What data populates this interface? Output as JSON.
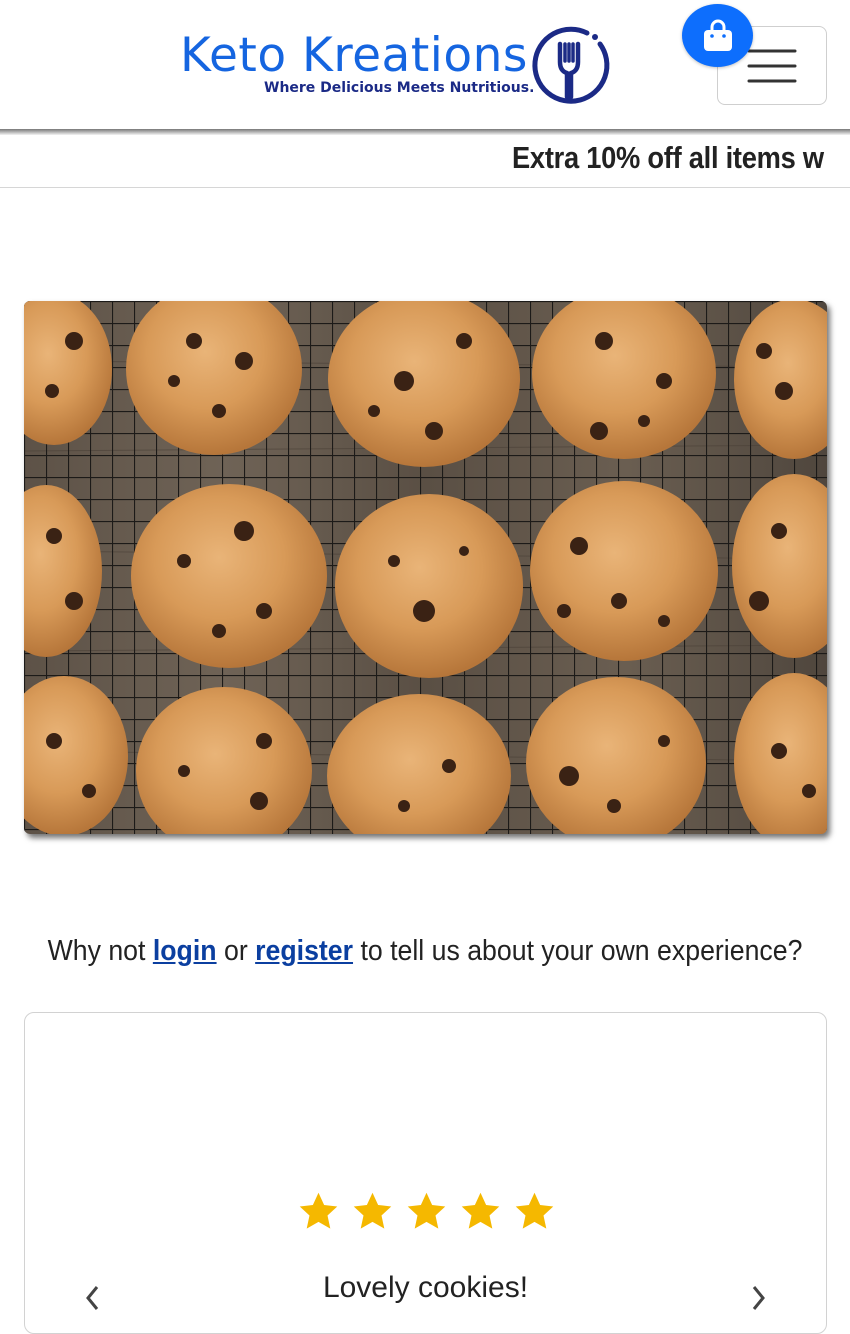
{
  "brand": {
    "name": "Keto Kreations",
    "tagline": "Where Delicious Meets Nutritious.",
    "color": "#1565e0",
    "tagline_color": "#1b2a86"
  },
  "header": {
    "cart_icon": "shopping-bag-icon",
    "cart_color": "#0d6efd",
    "menu_icon": "hamburger-menu-icon"
  },
  "promo": {
    "text": "Extra 10% off all items w"
  },
  "hero": {
    "image": "chocolate-chip-cookies-on-cooling-rack"
  },
  "cta": {
    "prefix": "Why not",
    "login": "login",
    "middle": "or",
    "register": "register",
    "suffix": "to tell us about your own experience?",
    "link_color": "#0b3fa0"
  },
  "review": {
    "rating": 5,
    "max_rating": 5,
    "star_color": "#f5b800",
    "title": "Lovely cookies!",
    "prev_icon": "chevron-left-icon",
    "next_icon": "chevron-right-icon"
  }
}
